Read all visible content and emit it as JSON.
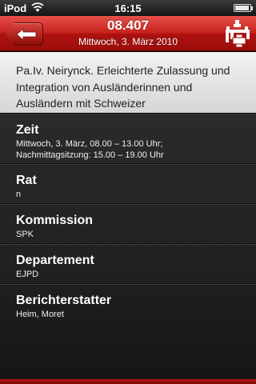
{
  "status_bar": {
    "carrier": "iPod",
    "time": "16:15",
    "battery_level": 0.9,
    "icons": [
      "wifi-icon",
      "battery-icon"
    ]
  },
  "nav": {
    "title": "08.407",
    "subtitle": "Mittwoch, 3. März 2010",
    "back_icon": "left-arrow-icon",
    "logo_icon": "parliament-cross-logo-icon"
  },
  "colors": {
    "accent": "#c4211c",
    "title_block_bg": "#e6e6e6",
    "content_bg": "#222222"
  },
  "detail": {
    "title": "Pa.Iv. Neirynck. Erleichterte Zulassung und Integration von Ausländerinnen und Ausländern mit Schweizer",
    "sections": [
      {
        "label": "Zeit",
        "value_lines": [
          "Mittwoch, 3. März, 08.00 – 13.00 Uhr;",
          "Nachmittagsitzung: 15.00 – 19.00 Uhr"
        ]
      },
      {
        "label": "Rat",
        "value": "n"
      },
      {
        "label": "Kommission",
        "value": "SPK"
      },
      {
        "label": "Departement",
        "value": "EJPD"
      },
      {
        "label": "Berichterstatter",
        "value": "Heim, Moret"
      }
    ]
  }
}
